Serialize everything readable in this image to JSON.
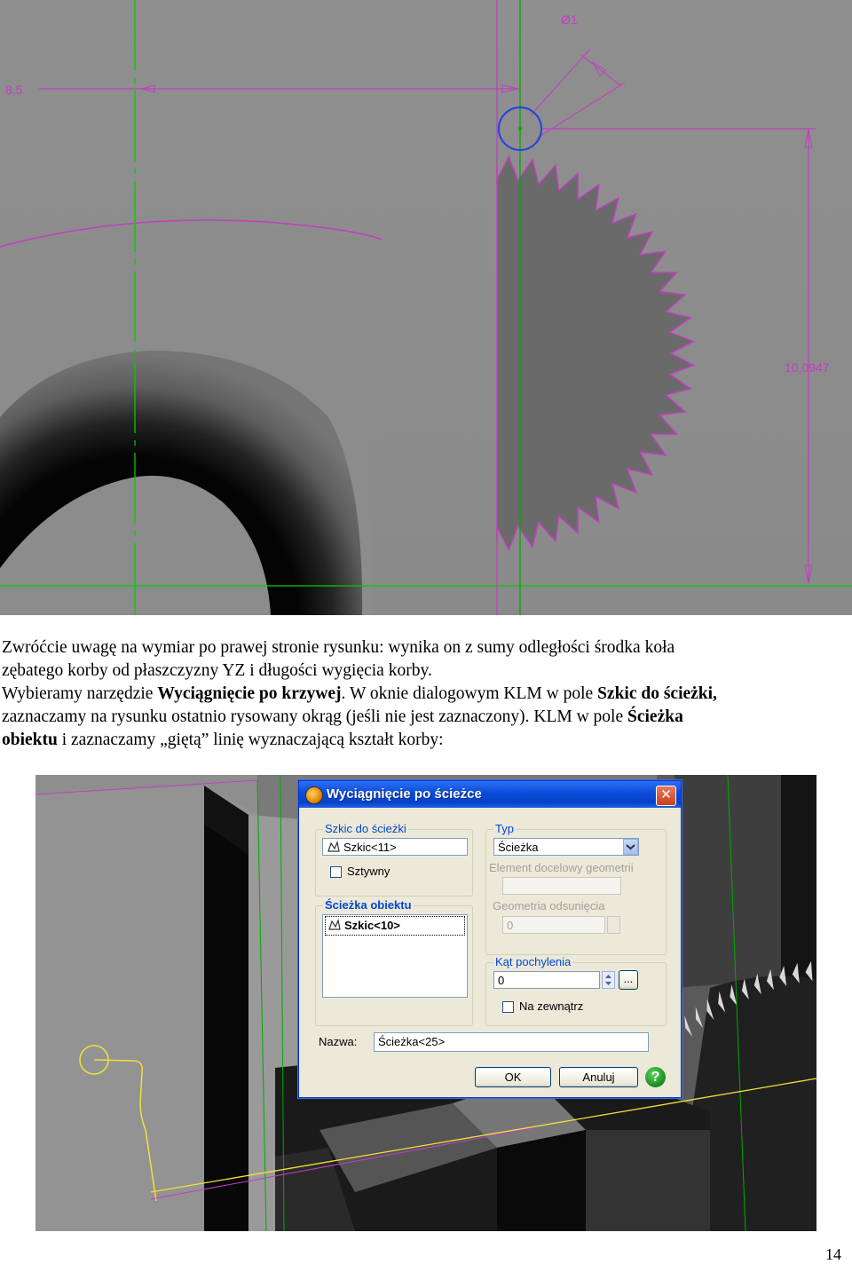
{
  "cad_top": {
    "dimension_left": "8,5",
    "dimension_diameter": "Ø1",
    "dimension_right": "10,0947"
  },
  "paragraph": {
    "line1": "Zwróćcie uwagę na wymiar po prawej stronie rysunku: wynika on z sumy odległości środka koła",
    "line2": "zębatego korby od płaszczyzny YZ i długości wygięcia korby.",
    "line3_prefix": "Wybieramy narzędzie ",
    "line3_bold": "Wyciągnięcie po krzywej",
    "line3_mid": ". W oknie dialogowym KLM w pole ",
    "line3_bold2": "Szkic do ścieżki,",
    "line4": "zaznaczamy na rysunku ostatnio rysowany okrąg (jeśli nie jest zaznaczony). KLM w pole ",
    "line4_bold": "Ścieżka",
    "line5_bold": "obiektu",
    "line5": " i zaznaczamy „giętą” linię wyznaczającą kształt korby:"
  },
  "dialog": {
    "title": "Wyciągnięcie po ścieżce",
    "close_label": "✕",
    "group_profile": "Szkic do ścieżki",
    "profile_value": "Szkic<11>",
    "rigid_label": "Sztywny",
    "group_path": "Ścieżka obiektu",
    "path_value": "Szkic<10>",
    "group_type": "Typ",
    "type_value": "Ścieżka",
    "target_label": "Element docelowy geometrii",
    "target_value": "",
    "offset_label": "Geometria odsunięcia",
    "offset_value": "0",
    "group_draft": "Kąt pochylenia",
    "draft_value": "0",
    "browse_label": "...",
    "outward_label": "Na zewnątrz",
    "name_label": "Nazwa:",
    "name_value": "Ścieżka<25>",
    "ok_label": "OK",
    "cancel_label": "Anuluj",
    "help_label": "?"
  },
  "page_number": "14"
}
